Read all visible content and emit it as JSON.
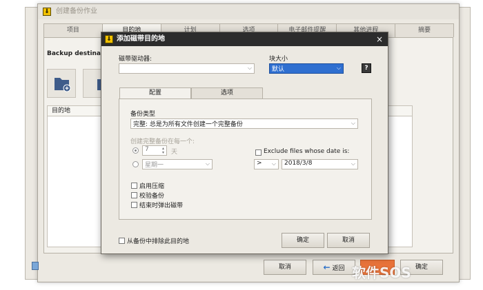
{
  "main_window": {
    "title": "创建备份作业",
    "tabs": [
      "项目",
      "目的地",
      "计划",
      "选项",
      "电子邮件提醒",
      "其他进程",
      "摘要"
    ],
    "section_label": "Backup destination",
    "list_header": "目的地",
    "buttons": {
      "cancel": "取消",
      "back": "返回",
      "ok": "确定"
    }
  },
  "dialog": {
    "title": "添加磁带目的地",
    "close_glyph": "×",
    "tape_drive_label": "磁带驱动器:",
    "tape_drive_value": "",
    "block_size_label": "块大小",
    "block_size_value": "默认",
    "help_glyph": "?",
    "tabs": [
      "配置",
      "选项"
    ],
    "backup_type_label": "备份类型",
    "backup_type_value": "完整: 总是为所有文件创建一个完整备份",
    "full_every_label": "创建完整备份在每一个:",
    "days_value": "7",
    "days_unit": "天",
    "weekday_value": "星期一",
    "exclude_label": "Exclude files whose date is:",
    "operator_value": ">",
    "date_value": "2018/3/8",
    "compress_label": "启用压缩",
    "verify_label": "校验备份",
    "eject_label": "结束时弹出磁带",
    "exclude_dest_label": "从备份中排除此目的地",
    "ok_button": "确定",
    "cancel_button": "取消"
  },
  "watermark": "软件SOS",
  "colors": {
    "titlebar_dark": "#2c2c2c",
    "selection": "#2f6fd0",
    "accent_orange": "#e8733a",
    "back_arrow": "#2a6fc9"
  }
}
